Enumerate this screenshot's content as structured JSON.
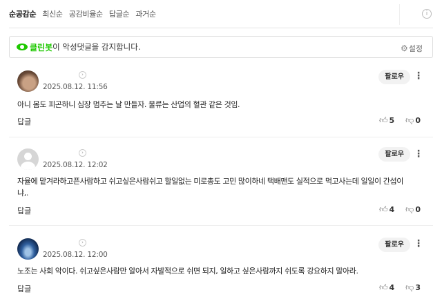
{
  "sort_tabs": [
    "순공감순",
    "최신순",
    "공감비율순",
    "답글순",
    "과거순"
  ],
  "info_icon": "ⓘ",
  "cleanbot": {
    "brand": "클린봇",
    "message": "이 악성댓글을 감지합니다.",
    "settings_label": "설정"
  },
  "comments": [
    {
      "date": "2025.08.12. 11:56",
      "follow_label": "팔로우",
      "text": "아니 몸도 피곤하니 심장 멈추는 날 만들자. 물류는 산업의 혈관 같은 것임.",
      "reply_label": "답글",
      "likes": "5",
      "dislikes": "0"
    },
    {
      "date": "2025.08.12. 12:02",
      "follow_label": "팔로우",
      "text": "자율에 맡겨라하고픈사람하고 쉬고싶은사람쉬고 할일없는 미로총도 고민 많이하네 택배맨도 실적으로 먹고사는데 일일이 간섭이냐,.",
      "reply_label": "답글",
      "likes": "4",
      "dislikes": "0"
    },
    {
      "date": "2025.08.12. 12:00",
      "follow_label": "팔로우",
      "text": "노조는 사회 악이다. 쉬고싶은사람만 알아서 자발적으로 쉬면 되지, 일하고 싶은사람까지 쉬도록 강요하지 말아라.",
      "reply_label": "답글",
      "likes": "4",
      "dislikes": "3"
    }
  ]
}
